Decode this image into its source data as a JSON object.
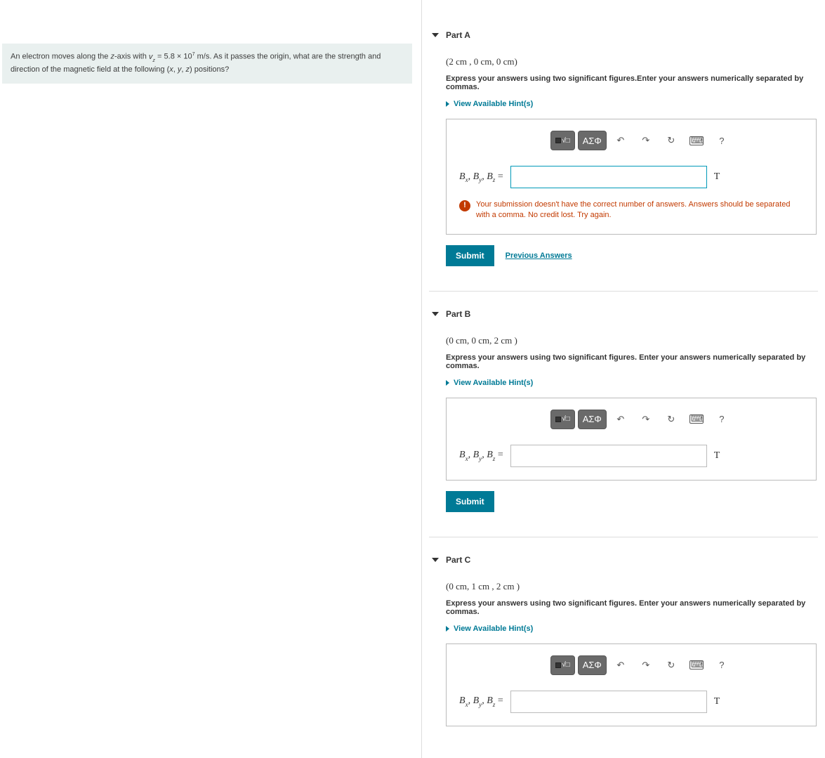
{
  "problem": {
    "text_prefix": "An electron moves along the ",
    "axis_label": "z",
    "text_mid_1": "-axis with ",
    "velocity_symbol": "v",
    "velocity_sub": "z",
    "velocity_value": "5.8 × 10",
    "velocity_exp": "7",
    "velocity_unit": " m/s",
    "text_mid_2": ". As it passes the origin, what are the strength and direction of the magnetic field at the following (",
    "coord_x": "x",
    "coord_y": "y",
    "coord_z": "z",
    "text_suffix": ") positions?"
  },
  "common": {
    "hints_label": "View Available Hint(s)",
    "submit_label": "Submit",
    "prev_label": "Previous Answers",
    "symbols_label": "ΑΣΦ",
    "unit_label": "T",
    "var_prefix": "B",
    "equals": " = "
  },
  "parts": {
    "a": {
      "title": "Part A",
      "coords": "(2 cm , 0 cm, 0 cm)",
      "instr": "Express your answers using two significant figures.Enter your answers numerically separated by commas.",
      "error": "Your submission doesn't have the correct number of answers. Answers should be separated with a comma. No credit lost. Try again.",
      "show_error": true,
      "show_prev": true
    },
    "b": {
      "title": "Part B",
      "coords": "(0 cm, 0 cm, 2 cm )",
      "instr": "Express your answers using two significant figures. Enter your answers numerically separated by commas.",
      "show_error": false,
      "show_prev": false
    },
    "c": {
      "title": "Part C",
      "coords": "(0 cm, 1 cm , 2 cm )",
      "instr": "Express your answers using two significant figures. Enter your answers numerically separated by commas.",
      "show_error": false,
      "show_prev": false
    }
  }
}
